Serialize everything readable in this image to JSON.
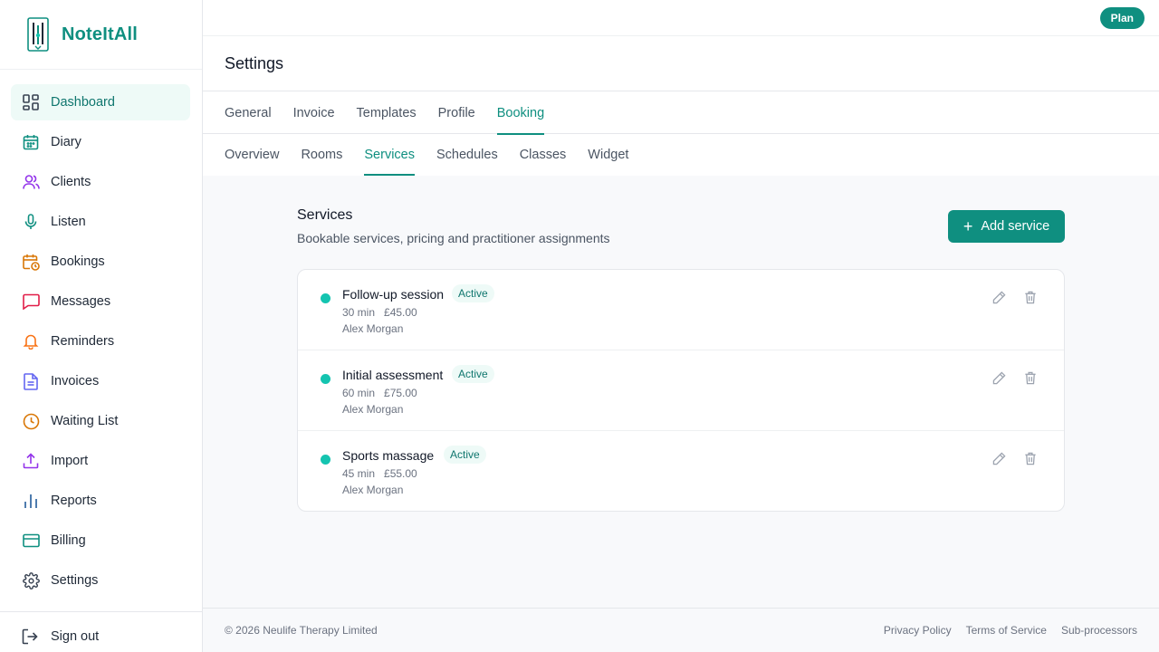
{
  "app": {
    "name": "NoteItAll"
  },
  "sidebar": {
    "items": [
      {
        "label": "Dashboard",
        "icon": "dashboard-icon",
        "color": "#374151",
        "active": true
      },
      {
        "label": "Diary",
        "icon": "calendar-icon",
        "color": "#0f8f80"
      },
      {
        "label": "Clients",
        "icon": "users-icon",
        "color": "#9333ea"
      },
      {
        "label": "Listen",
        "icon": "microphone-icon",
        "color": "#0f8f80"
      },
      {
        "label": "Bookings",
        "icon": "calendar-clock-icon",
        "color": "#d97706"
      },
      {
        "label": "Messages",
        "icon": "message-icon",
        "color": "#e11d48"
      },
      {
        "label": "Reminders",
        "icon": "bell-icon",
        "color": "#f97316"
      },
      {
        "label": "Invoices",
        "icon": "document-icon",
        "color": "#6366f1"
      },
      {
        "label": "Waiting List",
        "icon": "clock-icon",
        "color": "#d97706"
      },
      {
        "label": "Import",
        "icon": "upload-icon",
        "color": "#9333ea"
      },
      {
        "label": "Reports",
        "icon": "bar-chart-icon",
        "color": "#3b6ea5"
      },
      {
        "label": "Billing",
        "icon": "credit-card-icon",
        "color": "#0f8f80"
      },
      {
        "label": "Settings",
        "icon": "gear-icon",
        "color": "#374151"
      }
    ],
    "sign_out": "Sign out"
  },
  "topbar": {
    "plan_label": "Plan"
  },
  "page": {
    "title": "Settings"
  },
  "tabs": [
    {
      "label": "General"
    },
    {
      "label": "Invoice"
    },
    {
      "label": "Templates"
    },
    {
      "label": "Profile"
    },
    {
      "label": "Booking",
      "active": true
    }
  ],
  "subtabs": [
    {
      "label": "Overview"
    },
    {
      "label": "Rooms"
    },
    {
      "label": "Services",
      "active": true
    },
    {
      "label": "Schedules"
    },
    {
      "label": "Classes"
    },
    {
      "label": "Widget"
    }
  ],
  "services_section": {
    "title": "Services",
    "subtitle": "Bookable services, pricing and practitioner assignments",
    "add_label": "Add service",
    "items": [
      {
        "name": "Follow-up session",
        "status": "Active",
        "duration": "30 min",
        "price": "£45.00",
        "practitioner": "Alex Morgan"
      },
      {
        "name": "Initial assessment",
        "status": "Active",
        "duration": "60 min",
        "price": "£75.00",
        "practitioner": "Alex Morgan"
      },
      {
        "name": "Sports massage",
        "status": "Active",
        "duration": "45 min",
        "price": "£55.00",
        "practitioner": "Alex Morgan"
      }
    ]
  },
  "footer": {
    "copyright": "© 2026 Neulife Therapy Limited",
    "links": [
      "Privacy Policy",
      "Terms of Service",
      "Sub-processors"
    ]
  },
  "colors": {
    "accent": "#0f8f80",
    "status_dot": "#14c4b0"
  }
}
